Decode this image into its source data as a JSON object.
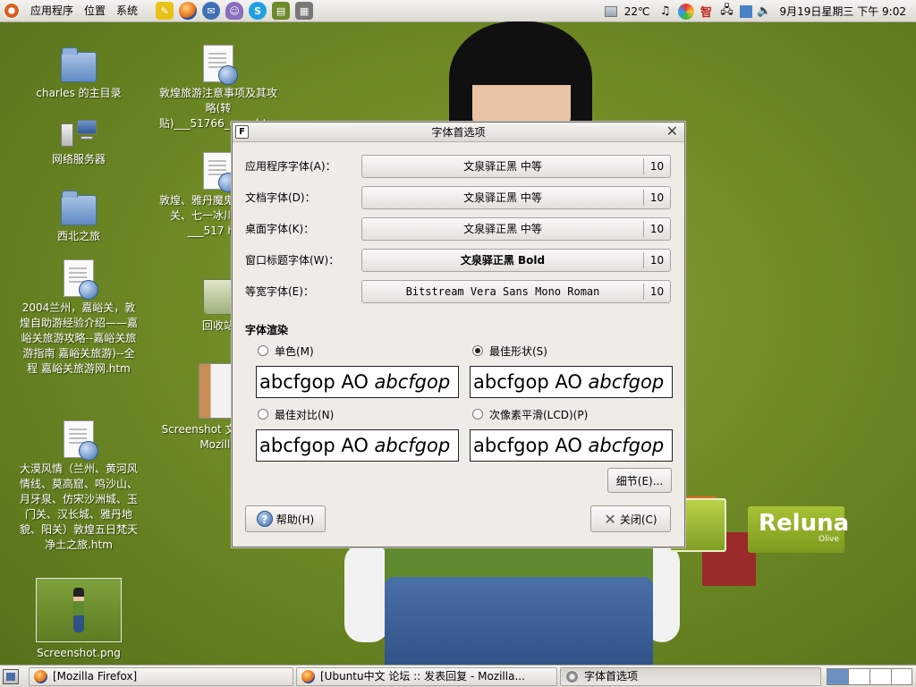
{
  "top_panel": {
    "menus": [
      {
        "label": "应用程序"
      },
      {
        "label": "位置"
      },
      {
        "label": "系统"
      }
    ],
    "launchers": [
      {
        "icon": "notes-icon",
        "color": "#e8c21a"
      },
      {
        "icon": "firefox-icon",
        "color": "#e2670f"
      },
      {
        "icon": "email-icon",
        "color": "#3e6fb6"
      },
      {
        "icon": "pidgin-icon",
        "color": "#8a6dbf"
      },
      {
        "icon": "skype-icon",
        "color": "#1fa0e3"
      },
      {
        "icon": "dictionary-icon",
        "color": "#6d8a2b"
      },
      {
        "icon": "calculator-icon",
        "color": "#777777"
      }
    ],
    "weather": "22℃",
    "clock": "9月19日星期三 下午 9:02",
    "tray_icons": [
      "music-note-icon",
      "stardict-icon",
      "scim-input-icon",
      "network-icon",
      "update-icon",
      "volume-icon"
    ],
    "scim_text": "智"
  },
  "desktop": {
    "icons": [
      {
        "label": "charles 的主目录",
        "type": "folder-home"
      },
      {
        "label": "网络服务器",
        "type": "network-server"
      },
      {
        "label": "西北之旅",
        "type": "folder"
      },
      {
        "label": "2004兰州，嘉峪关，敦煌自助游经验介绍——嘉峪关旅游攻略--嘉峪关旅游指南 嘉峪关旅游)--全程 嘉峪关旅游网.htm",
        "type": "html"
      },
      {
        "label": "大漠风情（兰州、黄河风情线、莫高窟、鸣沙山、月牙泉、仿宋沙洲城、玉门关、汉长城、雅丹地貌、阳关）敦煌五日梵天净土之旅.htm",
        "type": "html"
      },
      {
        "label": "Screenshot.png",
        "type": "image"
      },
      {
        "label": "敦煌旅游注意事项及其攻略(转贴)___51766_com.htm",
        "type": "html"
      },
      {
        "label": "敦煌、雅丹魔鬼城、嘉峪关、七一冰川行游记___517 htm",
        "type": "html"
      },
      {
        "label": "回收站",
        "type": "trash"
      },
      {
        "label": "Screenshot 文 论坛 : - Mozilla",
        "type": "image"
      }
    ],
    "brand": {
      "name": "Reluna",
      "sub": "Olive"
    }
  },
  "dialog": {
    "title": "字体首选项",
    "fonts": [
      {
        "label": "应用程序字体(A)：",
        "font": "文泉驿正黑 中等",
        "size": "10"
      },
      {
        "label": "文档字体(D)：",
        "font": "文泉驿正黑 中等",
        "size": "10"
      },
      {
        "label": "桌面字体(K)：",
        "font": "文泉驿正黑 中等",
        "size": "10"
      },
      {
        "label": "窗口标题字体(W)：",
        "font": "文泉驿正黑 Bold",
        "size": "10"
      },
      {
        "label": "等宽字体(E)：",
        "font": "Bitstream Vera Sans Mono Roman",
        "size": "10"
      }
    ],
    "rendering": {
      "heading": "字体渲染",
      "options": [
        {
          "label": "单色(M)",
          "selected": false
        },
        {
          "label": "最佳形状(S)",
          "selected": true
        },
        {
          "label": "最佳对比(N)",
          "selected": false
        },
        {
          "label": "次像素平滑(LCD)(P)",
          "selected": false
        }
      ],
      "sample_regular": "abcfgop AO ",
      "sample_italic": "abcfgop"
    },
    "details_button": "细节(E)...",
    "help_button": "帮助(H)",
    "close_button": "关闭(C)"
  },
  "bottom_panel": {
    "tasks": [
      {
        "label": "[Mozilla Firefox]"
      },
      {
        "label": "[Ubuntu中文 论坛 :: 发表回复 - Mozilla..."
      },
      {
        "label": "字体首选项"
      }
    ]
  }
}
